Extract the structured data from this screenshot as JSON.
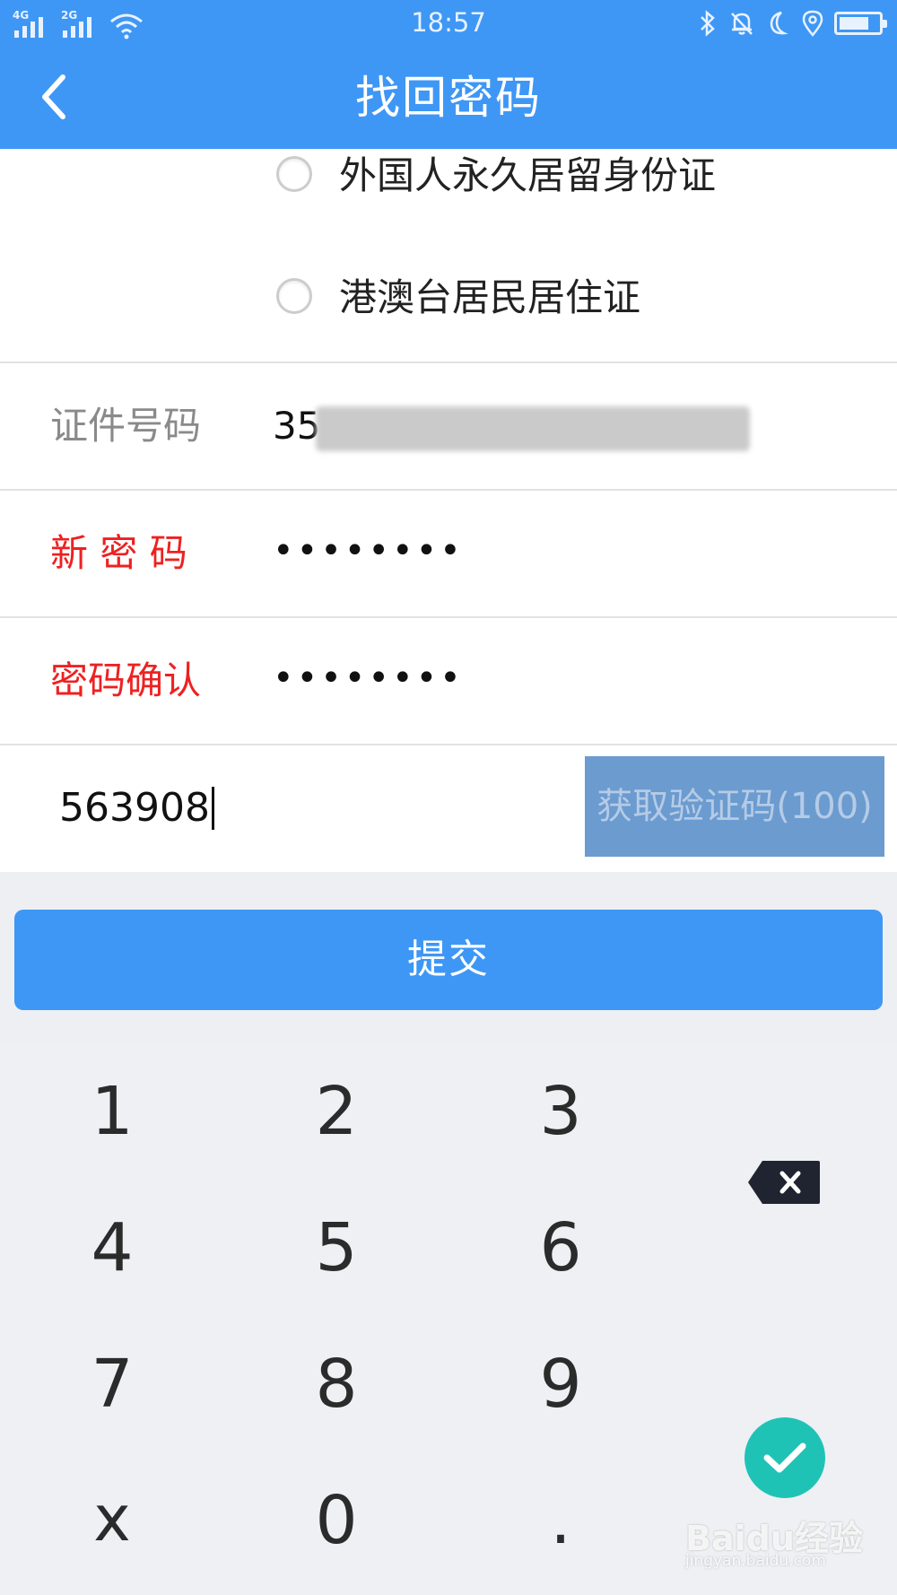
{
  "status_bar": {
    "network_1": "4G",
    "network_2": "2G",
    "time": "18:57",
    "icons": [
      "wifi-icon",
      "bluetooth-icon",
      "bell-off-icon",
      "moon-icon",
      "location-icon",
      "battery-icon"
    ],
    "battery_level": 0.75
  },
  "header": {
    "title": "找回密码",
    "back_icon": "chevron-left-icon"
  },
  "id_type_options": [
    {
      "label": "外国人永久居留身份证",
      "selected": false
    },
    {
      "label": "港澳台居民居住证",
      "selected": false
    }
  ],
  "form": {
    "id_number": {
      "label": "证件号码",
      "value_visible": "35"
    },
    "new_password": {
      "label": "新 密 码",
      "value": "••••••••"
    },
    "confirm_password": {
      "label": "密码确认",
      "value": "••••••••"
    },
    "verification": {
      "value": "563908",
      "button_label": "获取验证码(100)"
    }
  },
  "submit": {
    "label": "提交"
  },
  "keypad": {
    "keys": [
      "1",
      "2",
      "3",
      "4",
      "5",
      "6",
      "7",
      "8",
      "9",
      "x",
      "0",
      "."
    ],
    "backspace_icon": "backspace-icon",
    "confirm_icon": "checkmark-icon"
  },
  "watermark": {
    "brand": "Baidu经验",
    "sub": "jingyan.baidu.com"
  },
  "colors": {
    "primary": "#3e97f5",
    "label_red": "#ee2121",
    "label_gray": "#8a8a8a",
    "code_button": "#6b9bcf",
    "confirm_key": "#1fc3b6"
  }
}
